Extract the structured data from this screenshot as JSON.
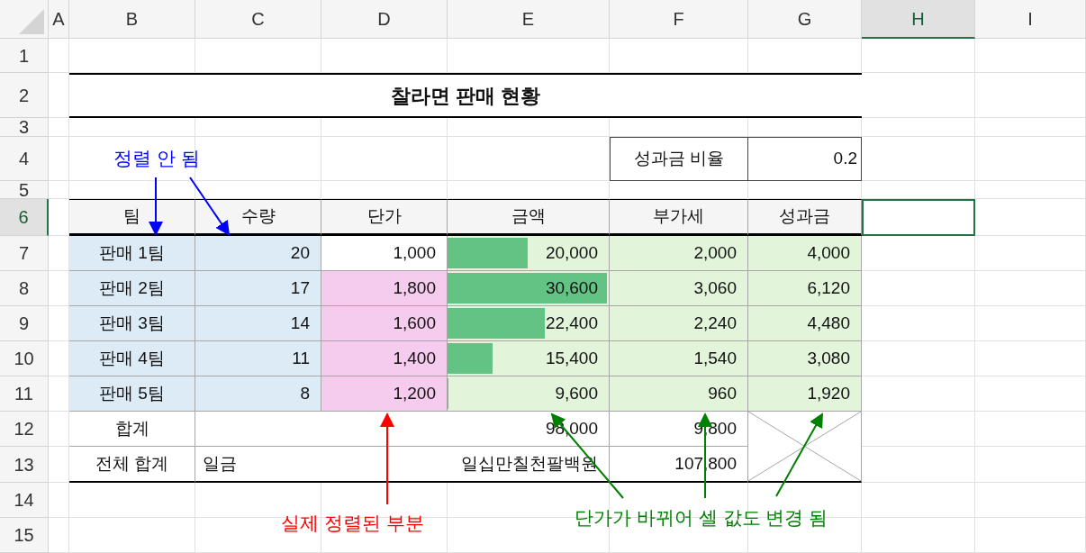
{
  "column_headers": [
    {
      "label": "A",
      "selected": false
    },
    {
      "label": "B",
      "selected": false
    },
    {
      "label": "C",
      "selected": false
    },
    {
      "label": "D",
      "selected": false
    },
    {
      "label": "E",
      "selected": false
    },
    {
      "label": "F",
      "selected": false
    },
    {
      "label": "G",
      "selected": false
    },
    {
      "label": "H",
      "selected": true
    },
    {
      "label": "I",
      "selected": false
    }
  ],
  "row_headers": [
    {
      "label": "1",
      "selected": false
    },
    {
      "label": "2",
      "selected": false
    },
    {
      "label": "3",
      "selected": false
    },
    {
      "label": "4",
      "selected": false
    },
    {
      "label": "5",
      "selected": false
    },
    {
      "label": "6",
      "selected": true
    },
    {
      "label": "7",
      "selected": false
    },
    {
      "label": "8",
      "selected": false
    },
    {
      "label": "9",
      "selected": false
    },
    {
      "label": "10",
      "selected": false
    },
    {
      "label": "11",
      "selected": false
    },
    {
      "label": "12",
      "selected": false
    },
    {
      "label": "13",
      "selected": false
    },
    {
      "label": "14",
      "selected": false
    },
    {
      "label": "15",
      "selected": false
    }
  ],
  "title": "찰라면 판매 현황",
  "bonus_rate": {
    "label": "성과금 비율",
    "value": "0.2"
  },
  "table": {
    "columns": [
      "팀",
      "수량",
      "단가",
      "금액",
      "부가세",
      "성과금"
    ],
    "rows": [
      {
        "team": "판매 1팀",
        "quantity": "20",
        "price": "1,000",
        "price_highlight": false,
        "amount": "20,000",
        "level": 0.5,
        "vat": "2,000",
        "bonus": "4,000"
      },
      {
        "team": "판매 2팀",
        "quantity": "17",
        "price": "1,800",
        "price_highlight": true,
        "amount": "30,600",
        "level": 1,
        "vat": "3,060",
        "bonus": "6,120"
      },
      {
        "team": "판매 3팀",
        "quantity": "14",
        "price": "1,600",
        "price_highlight": true,
        "amount": "22,400",
        "level": 0.61,
        "vat": "2,240",
        "bonus": "4,480"
      },
      {
        "team": "판매 4팀",
        "quantity": "11",
        "price": "1,400",
        "price_highlight": true,
        "amount": "15,400",
        "level": 0.28,
        "vat": "1,540",
        "bonus": "3,080"
      },
      {
        "team": "판매 5팀",
        "quantity": "8",
        "price": "1,200",
        "price_highlight": true,
        "amount": "9,600",
        "level": 0,
        "vat": "960",
        "bonus": "1,920"
      }
    ]
  },
  "totals": {
    "label": "합계",
    "amount": "98,000",
    "vat": "9,800"
  },
  "grand_total": {
    "label": "전체 합계",
    "prefix": "일금",
    "amount_words": "일십만칠천팔백원",
    "value": "107,800"
  },
  "annotations": [
    {
      "text": "정렬 안 됨",
      "color": "#0000ff"
    },
    {
      "text": "실제 정렬된 부분",
      "color": "#ff0000"
    },
    {
      "text": "단가가 바뀌어 셀 값도 변경 됨",
      "color": "#008000"
    }
  ]
}
